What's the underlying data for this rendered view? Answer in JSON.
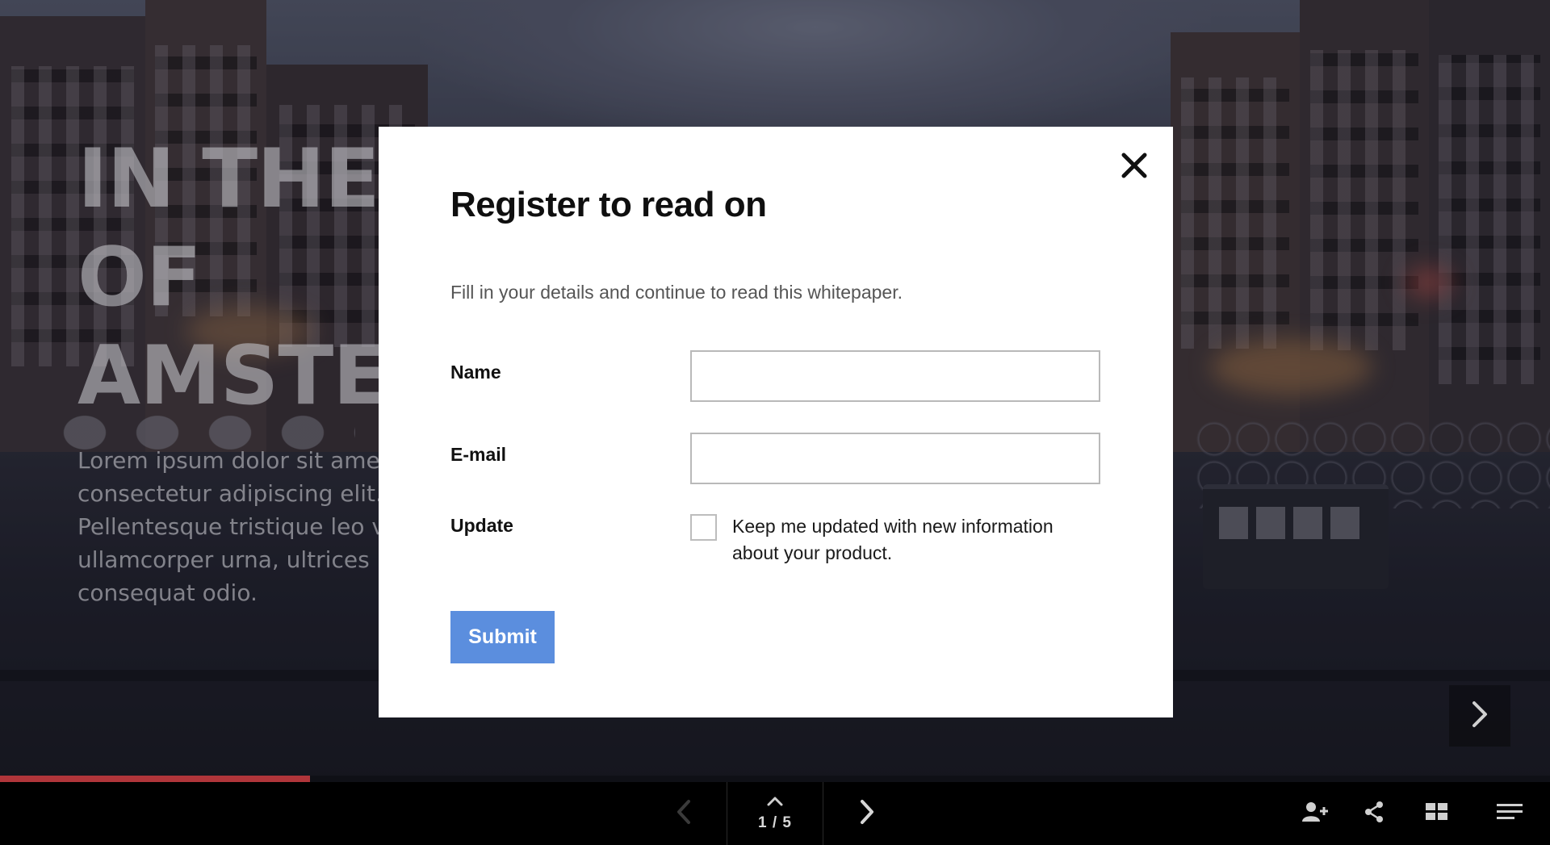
{
  "hero": {
    "title": "IN THE CITY OF AMSTERDAM",
    "body": "Lorem ipsum dolor sit amet, consectetur adipiscing elit. Pellentesque tristique leo vel, ullamcorper urna, ultrices pretium consequat odio."
  },
  "modal": {
    "title": "Register to read on",
    "description": "Fill in your details and continue to read this whitepaper.",
    "fields": {
      "name": {
        "label": "Name",
        "value": "",
        "placeholder": ""
      },
      "email": {
        "label": "E-mail",
        "value": "",
        "placeholder": ""
      }
    },
    "update": {
      "label": "Update",
      "checkbox_text": "Keep me updated with new information about your product.",
      "checked": false
    },
    "submit_label": "Submit"
  },
  "progress": {
    "fraction": 0.2,
    "color": "#b0353a"
  },
  "pager": {
    "label": "1 / 5",
    "current": 1,
    "total": 5
  },
  "toolbar": {
    "icons": [
      "chevron-left-icon",
      "chevron-up-icon",
      "chevron-right-icon",
      "add-user-icon",
      "share-icon",
      "grid-icon",
      "menu-icon"
    ]
  },
  "colors": {
    "submit_button": "#5b8ede",
    "modal_bg": "#ffffff",
    "bottom_bar": "#000000"
  }
}
